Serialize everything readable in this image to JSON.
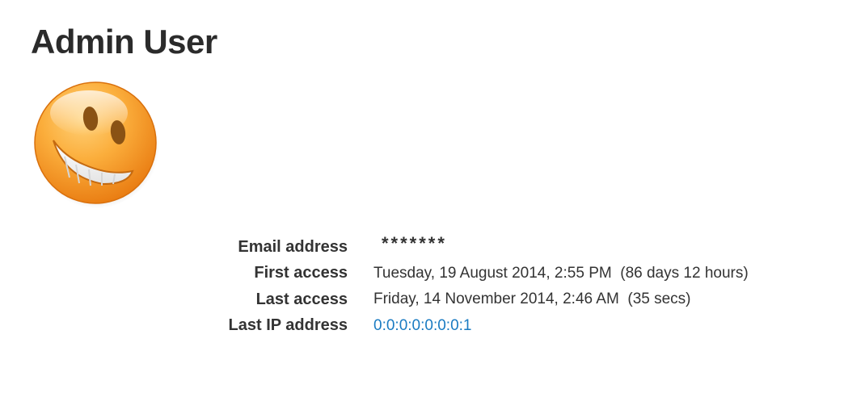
{
  "profile": {
    "title": "Admin User",
    "avatar_icon": "smiley-face-icon",
    "avatar_colors": {
      "face": "#f7941d",
      "eyes": "#7a4a12",
      "teeth": "#ffffff"
    },
    "fields": [
      {
        "label": "Email address",
        "value": "*******"
      },
      {
        "label": "First access",
        "value": "Tuesday, 19 August 2014, 2:55 PM  (86 days 12 hours)"
      },
      {
        "label": "Last access",
        "value": "Friday, 14 November 2014, 2:46 AM  (35 secs)"
      },
      {
        "label": "Last IP address",
        "value": "0:0:0:0:0:0:0:1"
      }
    ],
    "link_color": "#1a7bc2"
  }
}
